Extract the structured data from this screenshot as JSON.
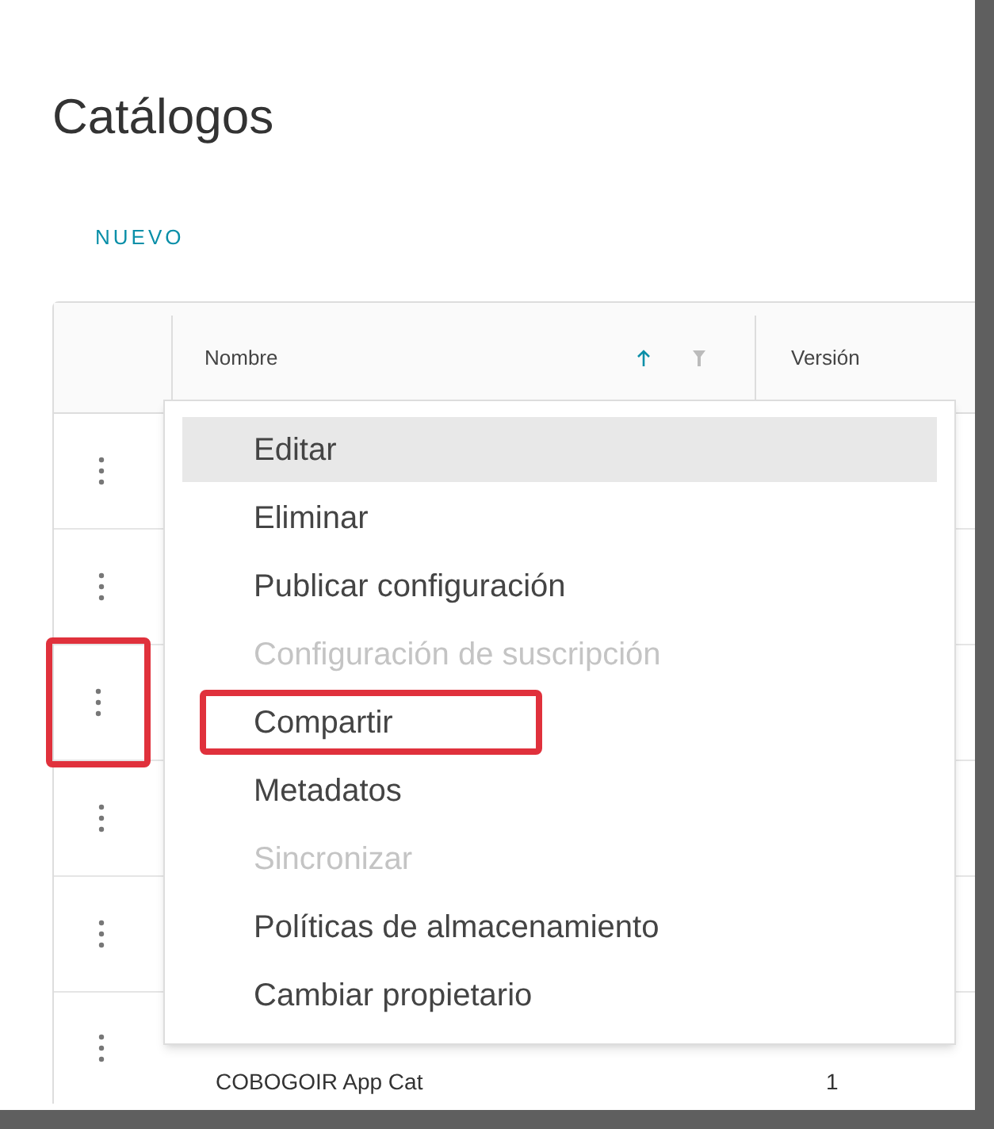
{
  "page": {
    "title": "Catálogos",
    "new_button": "NUEVO"
  },
  "table": {
    "columns": [
      {
        "label": "Nombre"
      },
      {
        "label": "Versión"
      }
    ],
    "rows": [
      {
        "highlighted": false
      },
      {
        "highlighted": false
      },
      {
        "highlighted": true
      },
      {
        "highlighted": false
      },
      {
        "highlighted": false
      },
      {
        "name": "COBOGOIR App Cat",
        "version": "1",
        "highlighted": false
      }
    ]
  },
  "menu": {
    "items": [
      {
        "label": "Editar",
        "selected": true,
        "disabled": false,
        "highlighted": false
      },
      {
        "label": "Eliminar",
        "selected": false,
        "disabled": false,
        "highlighted": false
      },
      {
        "label": "Publicar configuración",
        "selected": false,
        "disabled": false,
        "highlighted": false
      },
      {
        "label": "Configuración de suscripción",
        "selected": false,
        "disabled": true,
        "highlighted": false
      },
      {
        "label": "Compartir",
        "selected": false,
        "disabled": false,
        "highlighted": true
      },
      {
        "label": "Metadatos",
        "selected": false,
        "disabled": false,
        "highlighted": false
      },
      {
        "label": "Sincronizar",
        "selected": false,
        "disabled": true,
        "highlighted": false
      },
      {
        "label": "Políticas de almacenamiento",
        "selected": false,
        "disabled": false,
        "highlighted": false
      },
      {
        "label": "Cambiar propietario",
        "selected": false,
        "disabled": false,
        "highlighted": false
      }
    ]
  }
}
